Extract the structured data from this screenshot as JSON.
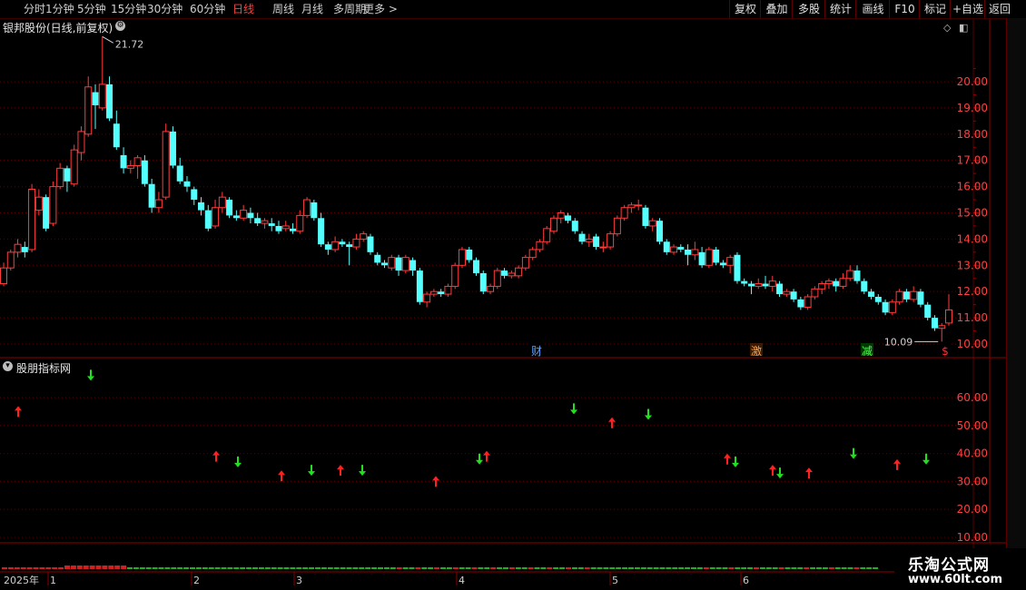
{
  "toolbar": {
    "left_items": [
      {
        "label": "分时",
        "active": false
      },
      {
        "label": "1分钟",
        "active": false
      },
      {
        "label": "5分钟",
        "active": false
      },
      {
        "label": "15分钟",
        "active": false
      },
      {
        "label": "30分钟",
        "active": false
      },
      {
        "label": "60分钟",
        "active": false
      },
      {
        "label": "日线",
        "active": true
      },
      {
        "label": "周线",
        "active": false
      },
      {
        "label": "月线",
        "active": false
      },
      {
        "label": "多周期",
        "active": false
      },
      {
        "label": "更多 >",
        "active": false
      }
    ],
    "right_items": [
      "复权",
      "叠加",
      "多股",
      "统计",
      "画线",
      "F10",
      "标记",
      "+自选",
      "返回"
    ]
  },
  "main_chart": {
    "title": "银邦股份(日线,前复权)",
    "high_marker": "21.72",
    "low_marker": "10.09",
    "price_ticks": [
      "20.00",
      "19.00",
      "18.00",
      "17.00",
      "16.00",
      "15.00",
      "14.00",
      "13.00",
      "12.00",
      "11.00",
      "10.00"
    ],
    "event_labels": [
      {
        "text": "财",
        "color": "#5aa0ff"
      },
      {
        "text": "激",
        "color": "#ffa040"
      },
      {
        "text": "减",
        "color": "#50ff50"
      },
      {
        "text": "$",
        "color": "#ff3030"
      }
    ]
  },
  "indicator": {
    "title": "股朋指标网",
    "ticks": [
      "60.00",
      "50.00",
      "40.00",
      "30.00",
      "20.00",
      "10.00"
    ]
  },
  "date_axis": {
    "labels": [
      "2025年",
      "1",
      "2",
      "3",
      "4",
      "5",
      "6"
    ]
  },
  "watermark": {
    "line1": "乐淘公式网",
    "line2": "www.60lt.com"
  },
  "colors": {
    "up": "#ff3c3c",
    "down": "#54ffff",
    "grid": "#5a0000",
    "arrow_up": "#ff2020",
    "arrow_down": "#20e020"
  },
  "chart_data": {
    "type": "candlestick",
    "y_range": [
      9.6,
      21.9
    ],
    "candles": [
      [
        12.3,
        12.9,
        13.1,
        12.2
      ],
      [
        12.9,
        13.5,
        13.6,
        12.8
      ],
      [
        13.5,
        13.8,
        14.0,
        13.3
      ],
      [
        13.7,
        13.5,
        13.9,
        13.3
      ],
      [
        13.6,
        15.9,
        16.1,
        13.5
      ],
      [
        15.1,
        15.6,
        15.9,
        14.9
      ],
      [
        15.6,
        14.4,
        15.7,
        14.3
      ],
      [
        14.6,
        16.0,
        16.2,
        14.5
      ],
      [
        16.0,
        16.7,
        16.9,
        15.9
      ],
      [
        16.7,
        16.2,
        16.8,
        15.8
      ],
      [
        16.1,
        17.4,
        17.6,
        16.0
      ],
      [
        17.3,
        18.1,
        18.3,
        17.0
      ],
      [
        18.0,
        19.8,
        20.2,
        17.9
      ],
      [
        19.6,
        19.1,
        19.9,
        18.2
      ],
      [
        19.0,
        19.9,
        21.72,
        18.9
      ],
      [
        19.9,
        18.6,
        20.2,
        18.5
      ],
      [
        18.4,
        17.5,
        18.9,
        17.4
      ],
      [
        17.2,
        16.7,
        17.5,
        16.5
      ],
      [
        16.7,
        16.8,
        17.0,
        16.5
      ],
      [
        16.8,
        17.1,
        17.2,
        16.3
      ],
      [
        17.0,
        16.1,
        17.2,
        16.0
      ],
      [
        16.1,
        15.2,
        16.3,
        15.0
      ],
      [
        15.2,
        15.5,
        15.8,
        15.0
      ],
      [
        15.6,
        18.1,
        18.4,
        15.5
      ],
      [
        18.1,
        16.8,
        18.3,
        16.7
      ],
      [
        16.8,
        16.2,
        17.1,
        16.1
      ],
      [
        16.2,
        16.0,
        16.4,
        15.8
      ],
      [
        15.9,
        15.5,
        16.0,
        15.3
      ],
      [
        15.4,
        15.1,
        15.6,
        14.9
      ],
      [
        15.1,
        14.4,
        15.3,
        14.3
      ],
      [
        14.5,
        15.2,
        15.5,
        14.4
      ],
      [
        15.2,
        15.6,
        15.8,
        15.0
      ],
      [
        15.5,
        14.9,
        15.6,
        14.8
      ],
      [
        14.9,
        14.8,
        15.1,
        14.7
      ],
      [
        14.8,
        15.1,
        15.3,
        14.7
      ],
      [
        15.0,
        14.8,
        15.2,
        14.6
      ],
      [
        14.8,
        14.6,
        15.0,
        14.5
      ],
      [
        14.6,
        14.7,
        14.8,
        14.4
      ],
      [
        14.6,
        14.5,
        14.8,
        14.3
      ],
      [
        14.5,
        14.3,
        14.7,
        14.2
      ],
      [
        14.4,
        14.5,
        14.7,
        14.3
      ],
      [
        14.4,
        14.3,
        14.6,
        14.2
      ],
      [
        14.3,
        14.9,
        15.1,
        14.2
      ],
      [
        14.9,
        15.5,
        15.6,
        14.8
      ],
      [
        15.4,
        14.8,
        15.5,
        14.7
      ],
      [
        14.8,
        13.8,
        15.0,
        13.7
      ],
      [
        13.8,
        13.6,
        13.9,
        13.4
      ],
      [
        13.6,
        13.9,
        14.1,
        13.5
      ],
      [
        13.9,
        13.8,
        14.0,
        13.7
      ],
      [
        13.8,
        13.7,
        13.9,
        13.0
      ],
      [
        13.7,
        14.0,
        14.2,
        13.6
      ],
      [
        14.0,
        14.2,
        14.3,
        13.9
      ],
      [
        14.1,
        13.5,
        14.2,
        13.4
      ],
      [
        13.4,
        13.1,
        13.5,
        13.0
      ],
      [
        13.1,
        13.0,
        13.2,
        12.9
      ],
      [
        12.9,
        13.3,
        13.4,
        12.8
      ],
      [
        13.3,
        12.8,
        13.4,
        12.6
      ],
      [
        12.8,
        13.3,
        13.4,
        12.7
      ],
      [
        13.2,
        12.8,
        13.3,
        12.6
      ],
      [
        12.8,
        11.6,
        12.9,
        11.5
      ],
      [
        11.6,
        11.9,
        12.0,
        11.4
      ],
      [
        11.9,
        12.0,
        12.1,
        11.8
      ],
      [
        12.0,
        11.9,
        12.1,
        11.8
      ],
      [
        11.9,
        12.2,
        12.3,
        11.8
      ],
      [
        12.2,
        13.0,
        13.1,
        12.1
      ],
      [
        13.0,
        13.6,
        13.7,
        12.9
      ],
      [
        13.6,
        13.2,
        13.7,
        13.1
      ],
      [
        13.2,
        12.7,
        13.3,
        12.6
      ],
      [
        12.7,
        12.0,
        12.8,
        11.9
      ],
      [
        12.0,
        12.2,
        12.3,
        11.9
      ],
      [
        12.2,
        12.8,
        12.9,
        12.1
      ],
      [
        12.8,
        12.6,
        12.9,
        12.5
      ],
      [
        12.6,
        12.7,
        12.8,
        12.5
      ],
      [
        12.6,
        12.9,
        13.0,
        12.5
      ],
      [
        12.9,
        13.3,
        13.4,
        12.8
      ],
      [
        13.3,
        13.6,
        13.7,
        13.2
      ],
      [
        13.6,
        13.9,
        14.0,
        13.5
      ],
      [
        13.9,
        14.4,
        14.5,
        13.8
      ],
      [
        14.3,
        14.8,
        14.9,
        14.2
      ],
      [
        14.8,
        15.0,
        15.1,
        14.6
      ],
      [
        14.9,
        14.7,
        15.0,
        14.6
      ],
      [
        14.7,
        14.3,
        14.8,
        14.2
      ],
      [
        14.2,
        13.9,
        14.3,
        13.8
      ],
      [
        13.9,
        14.0,
        14.2,
        13.7
      ],
      [
        14.1,
        13.7,
        14.2,
        13.6
      ],
      [
        13.7,
        13.7,
        13.9,
        13.5
      ],
      [
        13.7,
        14.2,
        14.3,
        13.6
      ],
      [
        14.2,
        14.8,
        14.9,
        14.1
      ],
      [
        14.8,
        15.2,
        15.3,
        14.7
      ],
      [
        15.2,
        15.3,
        15.4,
        15.0
      ],
      [
        15.3,
        15.3,
        15.5,
        15.1
      ],
      [
        15.2,
        14.5,
        15.3,
        14.4
      ],
      [
        14.5,
        14.7,
        14.8,
        14.3
      ],
      [
        14.7,
        13.9,
        14.8,
        13.8
      ],
      [
        13.9,
        13.5,
        14.0,
        13.4
      ],
      [
        13.5,
        13.7,
        13.8,
        13.4
      ],
      [
        13.7,
        13.6,
        13.8,
        13.5
      ],
      [
        13.6,
        13.4,
        13.8,
        13.0
      ],
      [
        13.4,
        13.6,
        13.9,
        13.2
      ],
      [
        13.5,
        13.0,
        13.7,
        12.9
      ],
      [
        13.0,
        13.6,
        13.7,
        12.9
      ],
      [
        13.6,
        13.1,
        13.7,
        13.0
      ],
      [
        13.1,
        13.0,
        13.2,
        12.9
      ],
      [
        13.0,
        13.3,
        13.4,
        12.7
      ],
      [
        13.4,
        12.4,
        13.5,
        12.3
      ],
      [
        12.4,
        12.3,
        12.5,
        12.2
      ],
      [
        12.3,
        12.2,
        12.4,
        11.9
      ],
      [
        12.2,
        12.3,
        12.5,
        12.1
      ],
      [
        12.3,
        12.2,
        12.6,
        12.1
      ],
      [
        12.2,
        12.4,
        12.6,
        12.0
      ],
      [
        12.3,
        11.9,
        12.4,
        11.8
      ],
      [
        11.9,
        12.0,
        12.1,
        11.8
      ],
      [
        12.0,
        11.7,
        12.1,
        11.6
      ],
      [
        11.7,
        11.4,
        11.8,
        11.3
      ],
      [
        11.4,
        11.8,
        11.9,
        11.3
      ],
      [
        11.8,
        12.1,
        12.2,
        11.7
      ],
      [
        12.1,
        12.3,
        12.4,
        11.9
      ],
      [
        12.3,
        12.4,
        12.5,
        12.1
      ],
      [
        12.4,
        12.2,
        12.5,
        12.0
      ],
      [
        12.2,
        12.5,
        12.7,
        12.1
      ],
      [
        12.5,
        12.8,
        13.0,
        12.4
      ],
      [
        12.8,
        12.4,
        13.0,
        12.3
      ],
      [
        12.4,
        12.0,
        12.5,
        11.9
      ],
      [
        12.0,
        11.8,
        12.1,
        11.7
      ],
      [
        11.8,
        11.6,
        11.9,
        11.5
      ],
      [
        11.6,
        11.2,
        11.7,
        11.1
      ],
      [
        11.2,
        11.6,
        11.7,
        11.1
      ],
      [
        11.6,
        12.0,
        12.1,
        11.5
      ],
      [
        12.0,
        11.7,
        12.1,
        11.6
      ],
      [
        11.7,
        12.0,
        12.2,
        11.6
      ],
      [
        12.0,
        11.5,
        12.1,
        11.4
      ],
      [
        11.5,
        11.0,
        11.6,
        10.9
      ],
      [
        11.0,
        10.6,
        11.1,
        10.5
      ],
      [
        10.6,
        10.7,
        10.8,
        10.09
      ],
      [
        10.8,
        11.3,
        11.9,
        10.7
      ]
    ]
  }
}
